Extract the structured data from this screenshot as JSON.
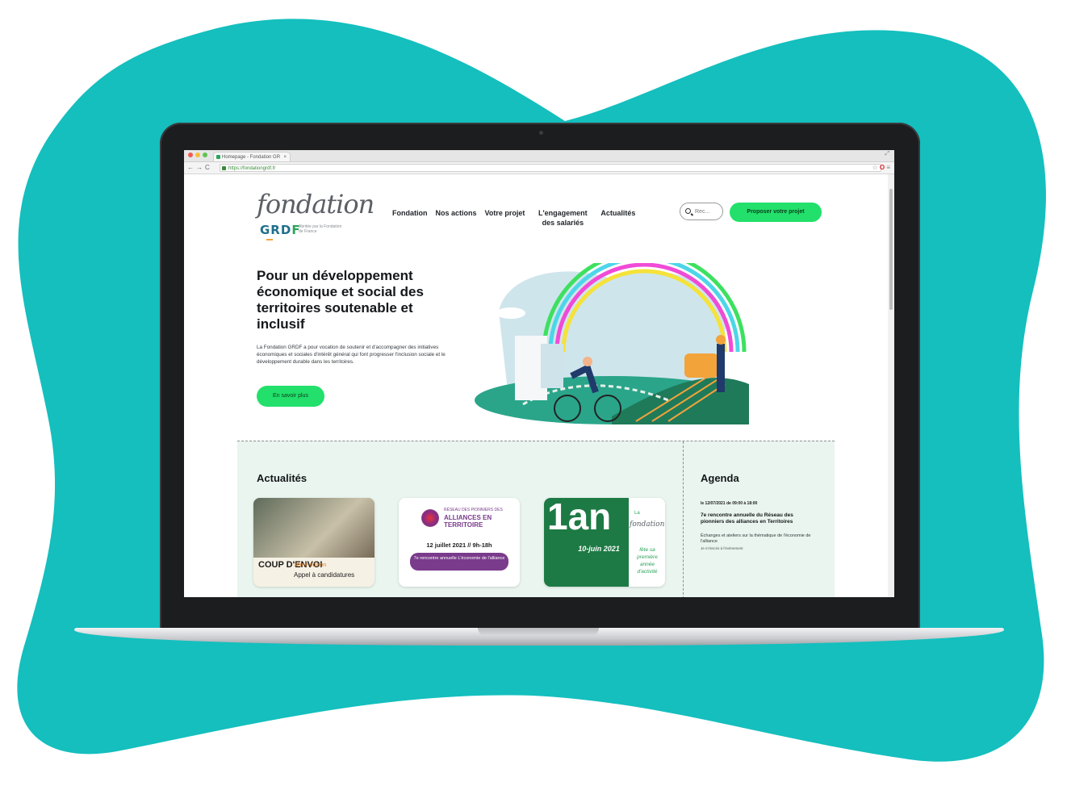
{
  "colors": {
    "blob": "#14bfbe",
    "accent_green": "#22e06b",
    "laptop_bezel": "#1c1d1f"
  },
  "browser": {
    "tab_title": "Homepage - Fondation GR",
    "url": "https://fondationgrdf.fr"
  },
  "site": {
    "logo_script": "fondation",
    "logo_brand": "GRDF",
    "logo_tagline": "Abritée par la Fondation de France",
    "nav": [
      {
        "label": "Fondation"
      },
      {
        "label": "Nos actions"
      },
      {
        "label": "Votre projet"
      },
      {
        "label": "L'engagement des salariés"
      },
      {
        "label": "Actualités"
      }
    ],
    "search_placeholder": "Rec...",
    "cta_label": "Proposer votre projet",
    "hero": {
      "title": "Pour un développement économique et social des territoires soutenable et inclusif",
      "text": "La Fondation GRDF a pour vocation de soutenir et d'accompagner des initiatives économiques et sociales d'intérêt général qui font progresser l'inclusion sociale et le développement durable dans les territoires.",
      "button": "En savoir plus"
    },
    "news": {
      "title": "Actualités",
      "cards": [
        {
          "brand": "COUP D'ENVOI",
          "edition": "3ème édition",
          "subtitle": "Appel à candidatures"
        },
        {
          "kicker": "RÉSEAU DES PIONNIERS DES",
          "title": "ALLIANCES EN TERRITOIRE",
          "date": "12 juillet 2021 // 9h-18h",
          "pill": "7e rencontre annuelle L'économie de l'alliance"
        },
        {
          "big": "1an",
          "date": "10-juin 2021",
          "kicker": "La",
          "logo": "fondation",
          "side": "fête sa première année d'activité"
        }
      ]
    },
    "agenda": {
      "title": "Agenda",
      "date": "le 12/07/2021 de 09:00 à 18:00",
      "event_title": "7e rencontre annuelle du Réseau des pionniers des alliances en Territoires",
      "description": "Échanges et ateliers sur la thématique de l'économie de l'alliance",
      "link": "Je m'inscris à l'évènement"
    }
  }
}
